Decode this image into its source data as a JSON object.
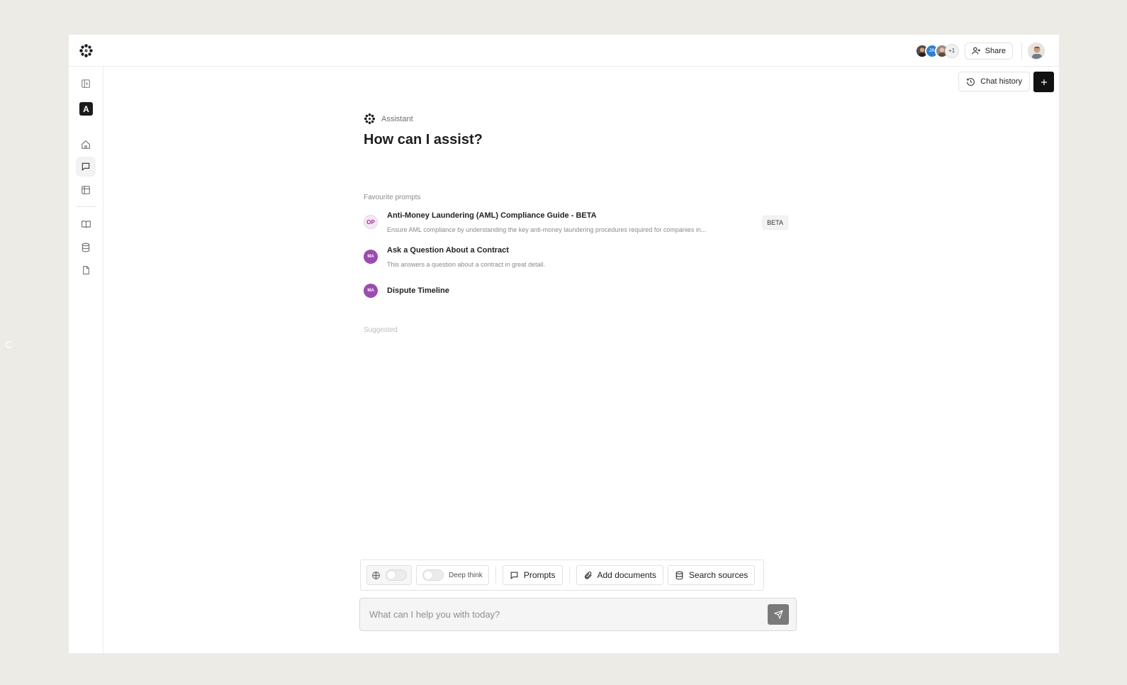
{
  "background_letter": "C",
  "header": {
    "collaborators": [
      "collaborator-1",
      "JA",
      "collaborator-3"
    ],
    "collaborator_overflow": "+1",
    "share_label": "Share"
  },
  "sidebar": {
    "workspace_badge": "A",
    "items": [
      {
        "icon": "sidebar-toggle-icon"
      },
      {
        "icon": "home-icon"
      },
      {
        "icon": "chat-icon",
        "active": true
      },
      {
        "icon": "table-icon"
      },
      {
        "icon": "book-icon"
      },
      {
        "icon": "database-icon"
      },
      {
        "icon": "document-icon"
      }
    ]
  },
  "actions": {
    "chat_history_label": "Chat history",
    "new_chat_icon": "plus-icon"
  },
  "main": {
    "assistant_label": "Assistant",
    "title": "How can I assist?",
    "favourites_label": "Favourite prompts",
    "prompts": [
      {
        "initials": "OP",
        "title": "Anti-Money Laundering (AML) Compliance Guide - BETA",
        "description": "Ensure AML compliance by understanding the key anti-money laundering procedures required for companies in...",
        "badge": "BETA"
      },
      {
        "initials": "MA",
        "title": "Ask a Question About a Contract",
        "description": "This answers a question about a contract in great detail."
      },
      {
        "initials": "MA",
        "title": "Dispute Timeline"
      }
    ],
    "suggested_label": "Suggested"
  },
  "composer": {
    "deep_think_label": "Deep think",
    "prompts_label": "Prompts",
    "add_documents_label": "Add documents",
    "search_sources_label": "Search sources",
    "input_placeholder": "What can I help you with today?",
    "input_value": ""
  },
  "colors": {
    "page_bg": "#ecebe6",
    "accent_dark": "#111111",
    "ma_avatar": "#9b4cb0",
    "op_avatar_text": "#9a2f8f",
    "send_button": "#7a7a7a"
  }
}
